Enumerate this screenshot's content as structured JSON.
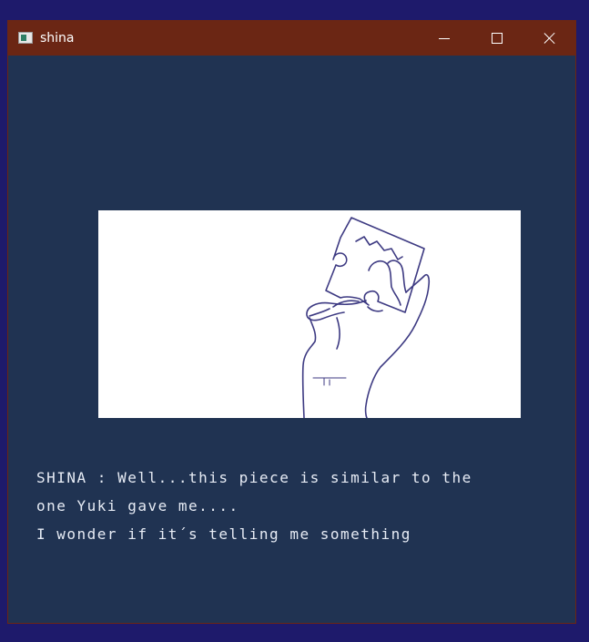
{
  "window": {
    "title": "shina",
    "controls": {
      "minimize": "minimize-icon",
      "maximize": "maximize-icon",
      "close": "close-icon"
    },
    "colors": {
      "titlebar": "#6b2614",
      "background": "#203352",
      "desktop": "#1e1a6b",
      "text": "#e7ecf5"
    }
  },
  "scene": {
    "image": "hand-holding-puzzle-piece"
  },
  "dialogue": {
    "lines": [
      "SHINA : Well...this piece is similar to the",
      "one Yuki gave me....",
      "I wonder if it´s telling me something"
    ]
  }
}
